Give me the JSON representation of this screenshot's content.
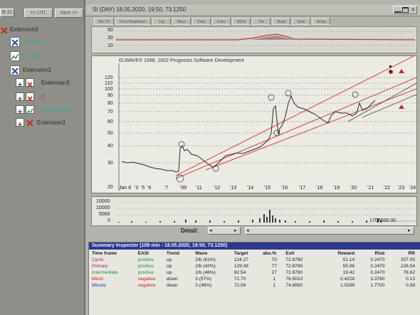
{
  "window": {
    "title": "SI (DAY) 18.05.2020, 19:50, 73.1250",
    "tabs": [
      "Bar Ch",
      "Price Breakdown",
      "Log",
      "Wave",
      "Ratio",
      "Extra",
      "Elliott",
      "Fib",
      "Study",
      "Stats",
      "Setup"
    ]
  },
  "left_panel": {
    "top_label": "B.11",
    "nav_back": "<< UTL",
    "nav_next": "Next >>",
    "tree": [
      {
        "label": "Extension3"
      },
      {
        "label": "Lorenzo"
      },
      {
        "label": "Lorenzo"
      },
      {
        "label": "Extension3"
      },
      {
        "label": "Extension3"
      },
      {
        "label": "C"
      },
      {
        "label": "Extension3"
      },
      {
        "label": "Extension3"
      }
    ]
  },
  "oscillator": {
    "ticks": [
      "50",
      "30",
      "10"
    ]
  },
  "chart": {
    "copyright": "ELWAVE® 1998, 2002 Prognosis Software Development",
    "y_ticks": [
      "120",
      "110",
      "100",
      "90",
      "80",
      "70",
      "60",
      "50",
      "40",
      "30",
      "20"
    ],
    "x_ticks": [
      "Jan 8",
      "'3",
      "'5",
      "'6",
      "'7",
      "'09",
      "'11",
      "'12",
      "'13",
      "'14",
      "'15",
      "'16",
      "'17",
      "'18",
      "'19",
      "'20",
      "'21",
      "'22",
      "'23",
      "'24"
    ]
  },
  "volume": {
    "ticks": [
      "15000",
      "10000",
      "5000",
      "0"
    ],
    "last_value": "1707000.00"
  },
  "detail_bar": {
    "label": "Detail:"
  },
  "summary": {
    "title": "Summary Inspector (109 min - 18.05.2020, 19:50, 73.1250)",
    "headers": [
      "Time frame",
      "EASI",
      "Trend",
      "Wave",
      "Target",
      "abs.%",
      "Exit",
      "Reward",
      "Risk",
      "RR"
    ],
    "rows": [
      {
        "timeframe": "Cycle",
        "easi": "positive",
        "trend": "up",
        "wave": "2/b (61%)",
        "target": "124.27",
        "abs": "70",
        "exit": "72.8780",
        "reward": "51.14",
        "risk": "0.2470",
        "rr": "207.05"
      },
      {
        "timeframe": "Primary",
        "easi": "positive",
        "trend": "up",
        "wave": "2/b (42%)",
        "target": "129.08",
        "abs": "77",
        "exit": "72.8780",
        "reward": "55.96",
        "risk": "0.2470",
        "rr": "226.54"
      },
      {
        "timeframe": "Intermediate",
        "easi": "positive",
        "trend": "up",
        "wave": "2/b (46%)",
        "target": "92.54",
        "abs": "27",
        "exit": "72.8780",
        "reward": "19.42",
        "risk": "0.2470",
        "rr": "78.62"
      },
      {
        "timeframe": "Minor",
        "easi": "negative",
        "trend": "down",
        "wave": "3 (57%)",
        "target": "72.70",
        "abs": "1",
        "exit": "76.5010",
        "reward": "0.4229",
        "risk": "3.3760",
        "rr": "0.13"
      },
      {
        "timeframe": "Minute",
        "easi": "negative",
        "trend": "down",
        "wave": "3 (46%)",
        "target": "72.09",
        "abs": "1",
        "exit": "74.8950",
        "reward": "1.0339",
        "risk": "1.7700",
        "rr": "0.58"
      }
    ]
  },
  "colors": {
    "cycle": "#b3205a",
    "primary": "#a01f6e",
    "intermediate": "#1e8f3c",
    "minor": "#c8202a",
    "minute": "#2233b8",
    "positive": "#1e8f3c",
    "negative": "#c8202a",
    "price": "#2a2a2a",
    "channel": "#d24848",
    "summary_header": "#2b3a8f"
  }
}
